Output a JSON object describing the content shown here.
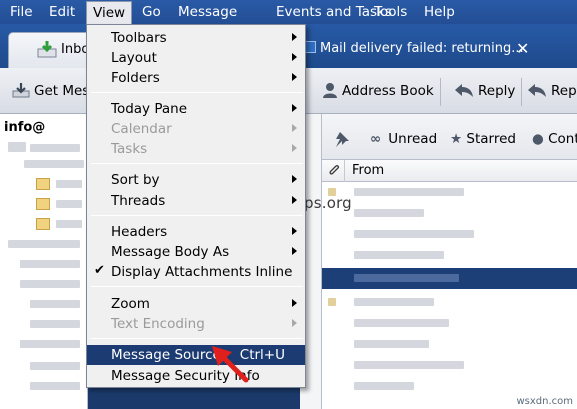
{
  "menubar": {
    "items": [
      "File",
      "Edit",
      "View",
      "Go",
      "Message",
      "Events and Tasks",
      "Tools",
      "Help"
    ]
  },
  "tabs": {
    "active_label": "Inbo",
    "second_label": "Mail delivery failed: returning...",
    "close_glyph": "✕"
  },
  "toolbar": {
    "get_messages": "Get Mes",
    "address_book": "Address Book",
    "reply": "Reply",
    "reply_all": "Reply"
  },
  "folder_pane": {
    "account": "info@"
  },
  "quick_filter": {
    "unread": "Unread",
    "starred": "Starred",
    "contact": "Cont"
  },
  "message_list": {
    "from_header": "From"
  },
  "view_menu": {
    "toolbars": "Toolbars",
    "layout": "Layout",
    "folders": "Folders",
    "today_pane": "Today Pane",
    "calendar": "Calendar",
    "tasks": "Tasks",
    "sort_by": "Sort by",
    "threads": "Threads",
    "headers": "Headers",
    "message_body_as": "Message Body As",
    "display_attachments_inline": "Display Attachments Inline",
    "zoom": "Zoom",
    "text_encoding": "Text Encoding",
    "message_source": "Message Source",
    "message_source_shortcut": "Ctrl+U",
    "message_security_info": "Message Security Info"
  },
  "watermark": "www.wintips.org",
  "footer_mark": "wsxdn.com",
  "colors": {
    "menubar": "#2a5aa6",
    "highlight": "#1d3b73",
    "selected_row": "#1d3f78",
    "arrow_red": "#e0201c"
  }
}
